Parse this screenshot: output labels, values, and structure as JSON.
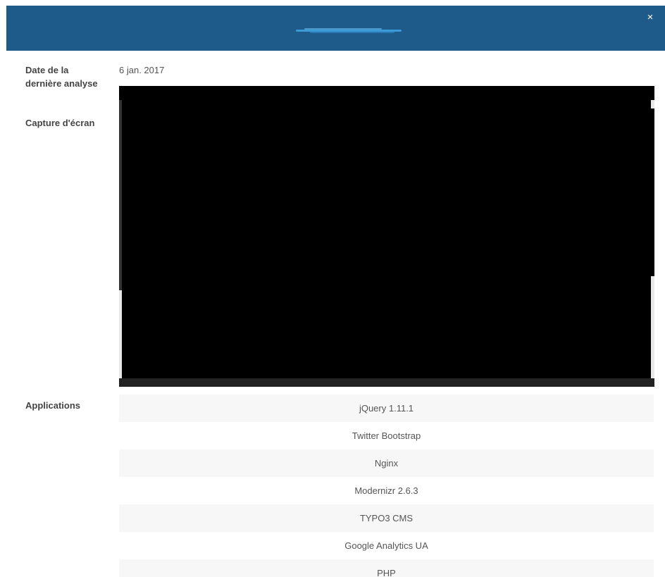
{
  "header": {
    "close_symbol": "×",
    "logo_icon": "brand-logo-icon"
  },
  "details": {
    "last_analysis_label": "Date de la dernière analyse",
    "last_analysis_value": "6 jan. 2017",
    "screenshot_label": "Capture d'écran",
    "applications_label": "Applications"
  },
  "applications": [
    "jQuery 1.11.1",
    "Twitter Bootstrap",
    "Nginx",
    "Modernizr 2.6.3",
    "TYPO3 CMS",
    "Google Analytics UA",
    "PHP"
  ],
  "colors": {
    "header_bg": "#1e5a8a",
    "stripe_bg": "#f7f7f7",
    "label_text": "#444444",
    "value_text": "#555555"
  }
}
